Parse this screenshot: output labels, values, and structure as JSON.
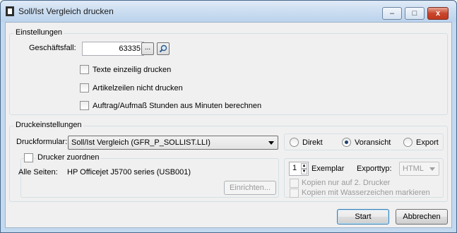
{
  "window": {
    "title": "Soll/Ist Vergleich drucken",
    "minimize": "–",
    "maximize": "□",
    "close": "x"
  },
  "einstellungen": {
    "group_title": "Einstellungen",
    "geschaeftsfall_label": "Geschäftsfall:",
    "geschaeftsfall_value": "63335",
    "browse_label": "...",
    "search_icon": "magnifier-icon",
    "checkboxes": [
      {
        "label": "Texte einzeilig drucken",
        "checked": false
      },
      {
        "label": "Artikelzeilen nicht drucken",
        "checked": false
      },
      {
        "label": "Auftrag/Aufmaß Stunden aus Minuten berechnen",
        "checked": false
      }
    ]
  },
  "druckeinstellungen": {
    "group_title": "Druckeinstellungen",
    "druckformular_label": "Druckformular:",
    "druckformular_value": "Soll/Ist Vergleich (GFR_P_SOLLIST.LLI)",
    "radios": [
      {
        "label": "Direkt",
        "selected": false
      },
      {
        "label": "Voransicht",
        "selected": true
      },
      {
        "label": "Export",
        "selected": false
      }
    ],
    "drucker_zuordnen_label": "Drucker zuordnen",
    "alle_seiten_label": "Alle Seiten:",
    "printer_name": "HP Officejet J5700 series (USB001)",
    "einrichten_label": "Einrichten...",
    "exemplar_value": "1",
    "exemplar_label": "Exemplar",
    "exporttyp_label": "Exporttyp:",
    "exporttyp_value": "HTML",
    "kopien_2_label": "Kopien nur auf 2. Drucker",
    "kopien_wasserzeichen_label": "Kopien mit Wasserzeichen markieren"
  },
  "footer": {
    "start_label": "Start",
    "abbrechen_label": "Abbrechen"
  }
}
